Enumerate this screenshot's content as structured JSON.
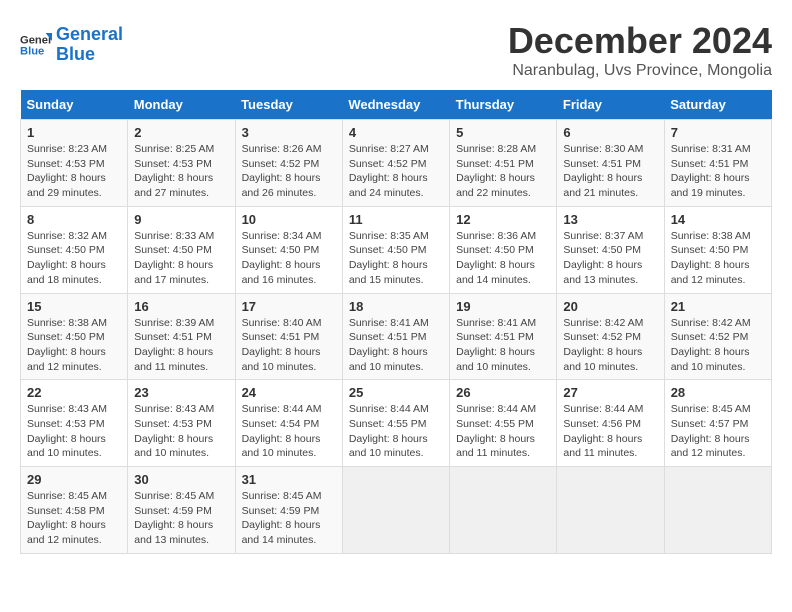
{
  "header": {
    "logo_line1": "General",
    "logo_line2": "Blue",
    "month": "December 2024",
    "location": "Naranbulag, Uvs Province, Mongolia"
  },
  "weekdays": [
    "Sunday",
    "Monday",
    "Tuesday",
    "Wednesday",
    "Thursday",
    "Friday",
    "Saturday"
  ],
  "weeks": [
    [
      {
        "day": "1",
        "detail": "Sunrise: 8:23 AM\nSunset: 4:53 PM\nDaylight: 8 hours\nand 29 minutes."
      },
      {
        "day": "2",
        "detail": "Sunrise: 8:25 AM\nSunset: 4:53 PM\nDaylight: 8 hours\nand 27 minutes."
      },
      {
        "day": "3",
        "detail": "Sunrise: 8:26 AM\nSunset: 4:52 PM\nDaylight: 8 hours\nand 26 minutes."
      },
      {
        "day": "4",
        "detail": "Sunrise: 8:27 AM\nSunset: 4:52 PM\nDaylight: 8 hours\nand 24 minutes."
      },
      {
        "day": "5",
        "detail": "Sunrise: 8:28 AM\nSunset: 4:51 PM\nDaylight: 8 hours\nand 22 minutes."
      },
      {
        "day": "6",
        "detail": "Sunrise: 8:30 AM\nSunset: 4:51 PM\nDaylight: 8 hours\nand 21 minutes."
      },
      {
        "day": "7",
        "detail": "Sunrise: 8:31 AM\nSunset: 4:51 PM\nDaylight: 8 hours\nand 19 minutes."
      }
    ],
    [
      {
        "day": "8",
        "detail": "Sunrise: 8:32 AM\nSunset: 4:50 PM\nDaylight: 8 hours\nand 18 minutes."
      },
      {
        "day": "9",
        "detail": "Sunrise: 8:33 AM\nSunset: 4:50 PM\nDaylight: 8 hours\nand 17 minutes."
      },
      {
        "day": "10",
        "detail": "Sunrise: 8:34 AM\nSunset: 4:50 PM\nDaylight: 8 hours\nand 16 minutes."
      },
      {
        "day": "11",
        "detail": "Sunrise: 8:35 AM\nSunset: 4:50 PM\nDaylight: 8 hours\nand 15 minutes."
      },
      {
        "day": "12",
        "detail": "Sunrise: 8:36 AM\nSunset: 4:50 PM\nDaylight: 8 hours\nand 14 minutes."
      },
      {
        "day": "13",
        "detail": "Sunrise: 8:37 AM\nSunset: 4:50 PM\nDaylight: 8 hours\nand 13 minutes."
      },
      {
        "day": "14",
        "detail": "Sunrise: 8:38 AM\nSunset: 4:50 PM\nDaylight: 8 hours\nand 12 minutes."
      }
    ],
    [
      {
        "day": "15",
        "detail": "Sunrise: 8:38 AM\nSunset: 4:50 PM\nDaylight: 8 hours\nand 12 minutes."
      },
      {
        "day": "16",
        "detail": "Sunrise: 8:39 AM\nSunset: 4:51 PM\nDaylight: 8 hours\nand 11 minutes."
      },
      {
        "day": "17",
        "detail": "Sunrise: 8:40 AM\nSunset: 4:51 PM\nDaylight: 8 hours\nand 10 minutes."
      },
      {
        "day": "18",
        "detail": "Sunrise: 8:41 AM\nSunset: 4:51 PM\nDaylight: 8 hours\nand 10 minutes."
      },
      {
        "day": "19",
        "detail": "Sunrise: 8:41 AM\nSunset: 4:51 PM\nDaylight: 8 hours\nand 10 minutes."
      },
      {
        "day": "20",
        "detail": "Sunrise: 8:42 AM\nSunset: 4:52 PM\nDaylight: 8 hours\nand 10 minutes."
      },
      {
        "day": "21",
        "detail": "Sunrise: 8:42 AM\nSunset: 4:52 PM\nDaylight: 8 hours\nand 10 minutes."
      }
    ],
    [
      {
        "day": "22",
        "detail": "Sunrise: 8:43 AM\nSunset: 4:53 PM\nDaylight: 8 hours\nand 10 minutes."
      },
      {
        "day": "23",
        "detail": "Sunrise: 8:43 AM\nSunset: 4:53 PM\nDaylight: 8 hours\nand 10 minutes."
      },
      {
        "day": "24",
        "detail": "Sunrise: 8:44 AM\nSunset: 4:54 PM\nDaylight: 8 hours\nand 10 minutes."
      },
      {
        "day": "25",
        "detail": "Sunrise: 8:44 AM\nSunset: 4:55 PM\nDaylight: 8 hours\nand 10 minutes."
      },
      {
        "day": "26",
        "detail": "Sunrise: 8:44 AM\nSunset: 4:55 PM\nDaylight: 8 hours\nand 11 minutes."
      },
      {
        "day": "27",
        "detail": "Sunrise: 8:44 AM\nSunset: 4:56 PM\nDaylight: 8 hours\nand 11 minutes."
      },
      {
        "day": "28",
        "detail": "Sunrise: 8:45 AM\nSunset: 4:57 PM\nDaylight: 8 hours\nand 12 minutes."
      }
    ],
    [
      {
        "day": "29",
        "detail": "Sunrise: 8:45 AM\nSunset: 4:58 PM\nDaylight: 8 hours\nand 12 minutes."
      },
      {
        "day": "30",
        "detail": "Sunrise: 8:45 AM\nSunset: 4:59 PM\nDaylight: 8 hours\nand 13 minutes."
      },
      {
        "day": "31",
        "detail": "Sunrise: 8:45 AM\nSunset: 4:59 PM\nDaylight: 8 hours\nand 14 minutes."
      },
      {
        "day": "",
        "detail": ""
      },
      {
        "day": "",
        "detail": ""
      },
      {
        "day": "",
        "detail": ""
      },
      {
        "day": "",
        "detail": ""
      }
    ]
  ]
}
